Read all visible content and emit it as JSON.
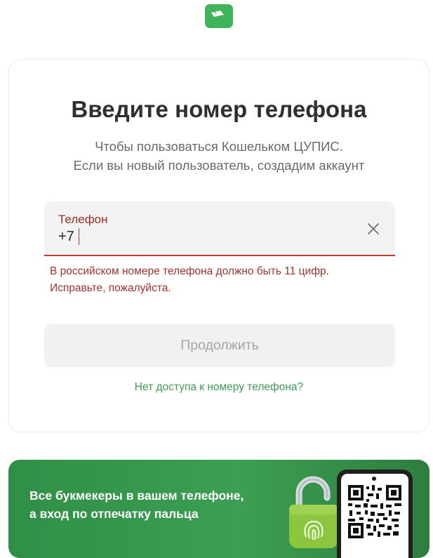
{
  "header": {
    "logo_icon": "wallet-icon",
    "brand_color": "#3fb45a"
  },
  "card": {
    "title": "Введите номер телефона",
    "subtitle_line1": "Чтобы пользоваться Кошельком ЦУПИС.",
    "subtitle_line2": "Если вы новый пользователь, создадим аккаунт"
  },
  "phone": {
    "label": "Телефон",
    "value": "+7",
    "clear_icon": "close-icon",
    "error_color": "#c0392b",
    "error_line1": "В российском номере телефона должно быть 11 цифр.",
    "error_line2": "Исправьте, пожалуйста."
  },
  "actions": {
    "continue_label": "Продолжить",
    "no_access_label": "Нет доступа к номеру телефона?",
    "link_color": "#3e9b54"
  },
  "promo": {
    "line1": "Все букмекеры в вашем телефоне,",
    "line2": "а вход по отпечатку пальца",
    "lock_icon": "fingerprint-lock-icon",
    "qr_icon": "qr-code-icon",
    "background_color": "#3c9f52"
  }
}
